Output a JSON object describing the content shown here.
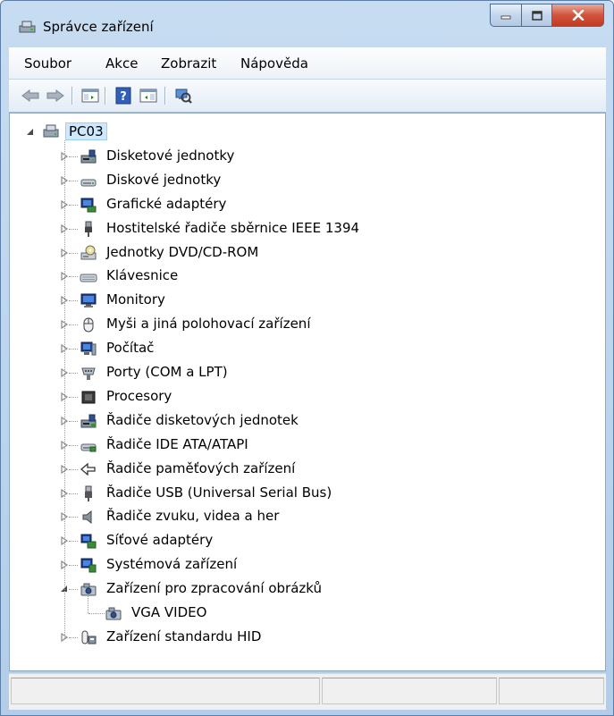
{
  "window": {
    "title": "Správce zařízení",
    "controls": {
      "minimize": "–",
      "maximize": "□",
      "close": "X"
    }
  },
  "menu": [
    "Soubor",
    "Akce",
    "Zobrazit",
    "Nápověda"
  ],
  "toolbar": {
    "icons": [
      "back-icon",
      "forward-icon",
      "show-hide-console-tree-icon",
      "help-icon",
      "show-hide-action-pane-icon",
      "scan-hardware-icon"
    ]
  },
  "tree": {
    "root": "PC03",
    "categories": [
      {
        "label": "Disketové jednotky",
        "icon": "floppy-drive-icon",
        "expanded": false
      },
      {
        "label": "Diskové jednotky",
        "icon": "disk-drive-icon",
        "expanded": false
      },
      {
        "label": "Grafické adaptéry",
        "icon": "display-adapter-icon",
        "expanded": false
      },
      {
        "label": "Hostitelské řadiče sběrnice IEEE 1394",
        "icon": "ieee1394-controller-icon",
        "expanded": false
      },
      {
        "label": "Jednotky DVD/CD-ROM",
        "icon": "dvd-drive-icon",
        "expanded": false
      },
      {
        "label": "Klávesnice",
        "icon": "keyboard-icon",
        "expanded": false
      },
      {
        "label": "Monitory",
        "icon": "monitor-icon",
        "expanded": false
      },
      {
        "label": "Myši a jiná polohovací zařízení",
        "icon": "mouse-icon",
        "expanded": false
      },
      {
        "label": "Počítač",
        "icon": "computer-icon",
        "expanded": false
      },
      {
        "label": "Porty (COM a LPT)",
        "icon": "port-icon",
        "expanded": false
      },
      {
        "label": "Procesory",
        "icon": "processor-icon",
        "expanded": false
      },
      {
        "label": "Řadiče disketových jednotek",
        "icon": "floppy-controller-icon",
        "expanded": false
      },
      {
        "label": "Řadiče IDE ATA/ATAPI",
        "icon": "ide-controller-icon",
        "expanded": false
      },
      {
        "label": "Řadiče paměťových zařízení",
        "icon": "storage-controller-icon",
        "expanded": false
      },
      {
        "label": "Řadiče USB (Universal Serial Bus)",
        "icon": "usb-controller-icon",
        "expanded": false
      },
      {
        "label": "Řadiče zvuku, videa a her",
        "icon": "sound-icon",
        "expanded": false
      },
      {
        "label": "Síťové adaptéry",
        "icon": "network-adapter-icon",
        "expanded": false
      },
      {
        "label": "Systémová zařízení",
        "icon": "system-device-icon",
        "expanded": false
      },
      {
        "label": "Zařízení pro zpracování obrázků",
        "icon": "imaging-device-icon",
        "expanded": true,
        "children": [
          {
            "label": "VGA VIDEO",
            "icon": "camera-icon"
          }
        ]
      },
      {
        "label": "Zařízení standardu HID",
        "icon": "hid-device-icon",
        "expanded": false
      }
    ]
  },
  "colors": {
    "frame": "#b9d1ea",
    "selection": "#cde8ff",
    "text": "#000000"
  }
}
